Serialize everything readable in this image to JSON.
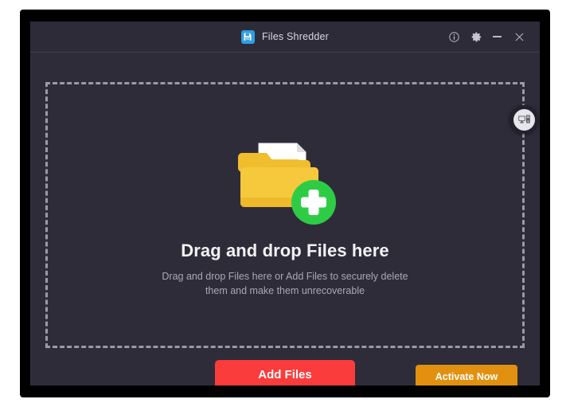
{
  "window": {
    "title": "Files Shredder",
    "app_icon": "floppy-disk-save-icon",
    "accent_blue": "#2e9fe0",
    "background": "#2f2c3a",
    "titlebar_background": "#2e2b39",
    "frame_color": "#000000",
    "controls": [
      {
        "name": "info",
        "icon": "info-circle-icon",
        "label": "Info"
      },
      {
        "name": "settings",
        "icon": "gear-icon",
        "label": "Settings"
      },
      {
        "name": "minimize",
        "icon": "minimize-icon",
        "label": "Minimize"
      },
      {
        "name": "close",
        "icon": "close-icon",
        "label": "Close"
      }
    ]
  },
  "dropzone": {
    "headline": "Drag and drop Files here",
    "subtext_line1": "Drag and drop Files here or Add Files to securely delete",
    "subtext_line2": "them and make them unrecoverable",
    "border_color": "#9a9aa6",
    "artwork": "folder-with-documents-and-green-plus-icon",
    "folder_color": "#f5c83a",
    "plus_badge_color": "#2ecc45"
  },
  "device_badge": {
    "icon": "desktop-computer-icon",
    "label": "Computer"
  },
  "actions": {
    "add_files_label": "Add Files",
    "add_files_color": "#fa3c3c",
    "activate_now_label": "Activate Now",
    "activate_now_color": "#e2900f"
  }
}
